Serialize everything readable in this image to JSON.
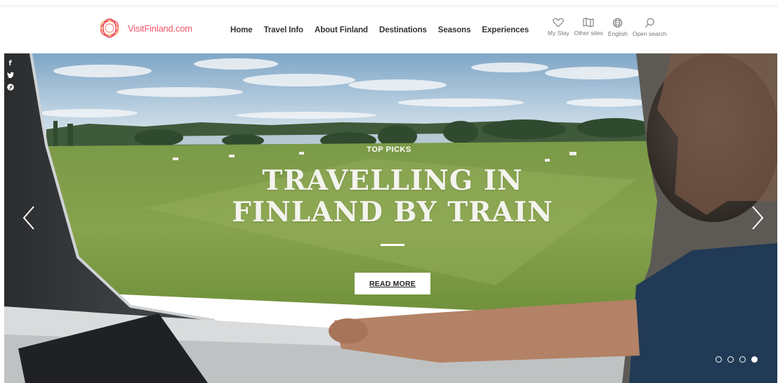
{
  "brand": {
    "logo_text": "VisitFinland.com",
    "accent": "#f0566a"
  },
  "nav": {
    "items": [
      {
        "label": "Home"
      },
      {
        "label": "Travel Info"
      },
      {
        "label": "About Finland"
      },
      {
        "label": "Destinations"
      },
      {
        "label": "Seasons"
      },
      {
        "label": "Experiences"
      }
    ]
  },
  "tools": {
    "my_stay": {
      "label": "My Stay",
      "icon": "heart-icon"
    },
    "other_sites": {
      "label": "Other sites",
      "icon": "map-icon"
    },
    "language": {
      "label": "English",
      "icon": "globe-icon"
    },
    "search": {
      "label": "Open search",
      "icon": "search-icon"
    }
  },
  "social": {
    "facebook": "f",
    "twitter": "t",
    "pinterest": "p"
  },
  "hero": {
    "eyebrow": "TOP PICKS",
    "headline_line1": "TRAVELLING IN",
    "headline_line2": "FINLAND BY TRAIN",
    "cta_label": "READ MORE",
    "prev_icon": "chevron-left-icon",
    "next_icon": "chevron-right-icon",
    "slides_total": 4,
    "active_slide": 4
  }
}
